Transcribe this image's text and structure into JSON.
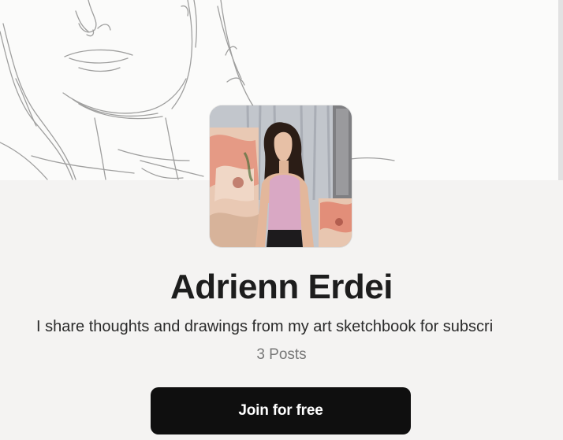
{
  "creator": {
    "name": "Adrienn Erdei",
    "tagline": "I share thoughts and drawings from my art sketchbook for subscri",
    "posts_count": "3 Posts"
  },
  "actions": {
    "join_label": "Join for free"
  },
  "colors": {
    "page_background": "#f4f3f2",
    "button_background": "#0f0f0f",
    "button_text": "#ffffff",
    "muted_text": "#777777"
  }
}
